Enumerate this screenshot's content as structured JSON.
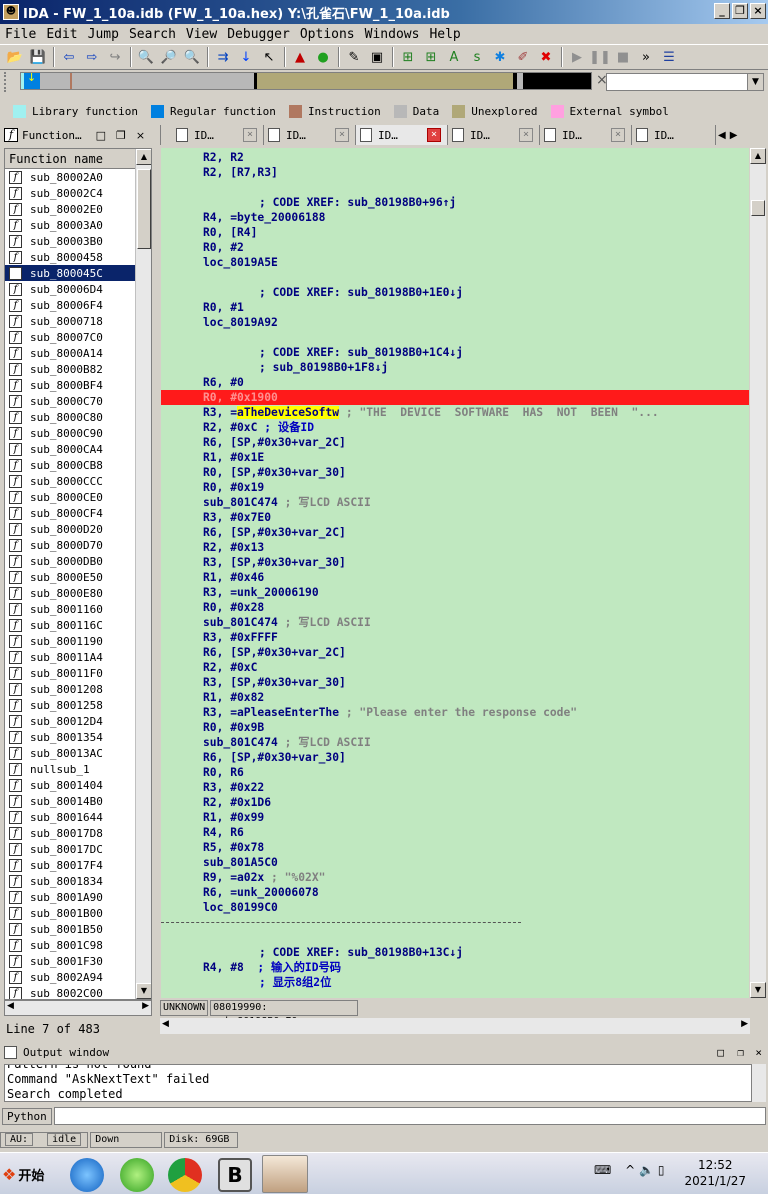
{
  "window": {
    "title": "IDA - FW_1_10a.idb (FW_1_10a.hex) Y:\\孔雀石\\FW_1_10a.idb"
  },
  "menu": [
    "File",
    "Edit",
    "Jump",
    "Search",
    "View",
    "Debugger",
    "Options",
    "Windows",
    "Help"
  ],
  "legend": [
    {
      "label": "Library function",
      "color": "#a0f0f0"
    },
    {
      "label": "Regular function",
      "color": "#0080e0"
    },
    {
      "label": "Instruction",
      "color": "#b07860"
    },
    {
      "label": "Data",
      "color": "#b8b8b8"
    },
    {
      "label": "Unexplored",
      "color": "#b0a878"
    },
    {
      "label": "External symbol",
      "color": "#ffa0e0"
    }
  ],
  "left_tab": {
    "label": "Function…"
  },
  "functions": {
    "header": "Function name",
    "items": [
      "sub_80002A0",
      "sub_80002C4",
      "sub_80002E0",
      "sub_80003A0",
      "sub_80003B0",
      "sub_8000458",
      "sub_800045C",
      "sub_80006D4",
      "sub_80006F4",
      "sub_8000718",
      "sub_80007C0",
      "sub_8000A14",
      "sub_8000B82",
      "sub_8000BF4",
      "sub_8000C70",
      "sub_8000C80",
      "sub_8000C90",
      "sub_8000CA4",
      "sub_8000CB8",
      "sub_8000CCC",
      "sub_8000CE0",
      "sub_8000CF4",
      "sub_8000D20",
      "sub_8000D70",
      "sub_8000DB0",
      "sub_8000E50",
      "sub_8000E80",
      "sub_8001160",
      "sub_800116C",
      "sub_8001190",
      "sub_80011A4",
      "sub_80011F0",
      "sub_8001208",
      "sub_8001258",
      "sub_80012D4",
      "sub_8001354",
      "sub_80013AC",
      "nullsub_1",
      "sub_8001404",
      "sub_80014B0",
      "sub_8001644",
      "sub_80017D8",
      "sub_80017DC",
      "sub_80017F4",
      "sub_8001834",
      "sub_8001A90",
      "sub_8001B00",
      "sub_8001B50",
      "sub_8001C98",
      "sub_8001F30",
      "sub_8002A94",
      "sub_8002C00"
    ],
    "selected_index": 6,
    "line_info": "Line 7 of 483"
  },
  "doc_tabs": [
    "ID…",
    "ID…",
    "ID…",
    "ID…",
    "ID…",
    "ID…"
  ],
  "disasm": [
    {
      "a": "R2, R2"
    },
    {
      "a": "R2, [R7,R3]"
    },
    {
      "blank": true
    },
    {
      "c": "; CODE XREF: sub_80198B0+96↑j",
      "ci": true
    },
    {
      "a": "R4, =byte_20006188"
    },
    {
      "a": "R0, [R4]"
    },
    {
      "a": "R0, #2"
    },
    {
      "a": "loc_8019A5E"
    },
    {
      "blank": true
    },
    {
      "c": "; CODE XREF: sub_80198B0+1E0↓j",
      "ci": true
    },
    {
      "a": "R0, #1"
    },
    {
      "a": "loc_8019A92"
    },
    {
      "blank": true
    },
    {
      "c": "; CODE XREF: sub_80198B0+1C4↓j",
      "ci": true
    },
    {
      "c": "; sub_80198B0+1F8↓j",
      "ci": true
    },
    {
      "a": "R6, #0"
    },
    {
      "a": "R0, #0x1900",
      "bp": true
    },
    {
      "a": "R3, =",
      "h": "aTheDeviceSoftw",
      "c": " ; \"THE  DEVICE  SOFTWARE  HAS  NOT  BEEN  \"..."
    },
    {
      "a": "R2, #0xC",
      "cb": " ; 设备ID"
    },
    {
      "a": "R6, [SP,#0x30+var_2C]"
    },
    {
      "a": "R1, #0x1E"
    },
    {
      "a": "R0, [SP,#0x30+var_30]"
    },
    {
      "a": "R0, #0x19"
    },
    {
      "a": "sub_801C474",
      "c": " ; 写LCD ASCII"
    },
    {
      "a": "R3, #0x7E0"
    },
    {
      "a": "R6, [SP,#0x30+var_2C]"
    },
    {
      "a": "R2, #0x13"
    },
    {
      "a": "R3, [SP,#0x30+var_30]"
    },
    {
      "a": "R1, #0x46"
    },
    {
      "a": "R3, =unk_20006190"
    },
    {
      "a": "R0, #0x28"
    },
    {
      "a": "sub_801C474",
      "c": " ; 写LCD ASCII"
    },
    {
      "a": "R3, #0xFFFF"
    },
    {
      "a": "R6, [SP,#0x30+var_2C]"
    },
    {
      "a": "R2, #0xC"
    },
    {
      "a": "R3, [SP,#0x30+var_30]"
    },
    {
      "a": "R1, #0x82"
    },
    {
      "a": "R3, =aPleaseEnterThe",
      "c": " ; \"Please enter the response code\""
    },
    {
      "a": "R0, #0x9B"
    },
    {
      "a": "sub_801C474",
      "c": " ; 写LCD ASCII"
    },
    {
      "a": "R6, [SP,#0x30+var_30]"
    },
    {
      "a": "R0, R6"
    },
    {
      "a": "R3, #0x22"
    },
    {
      "a": "R2, #0x1D6"
    },
    {
      "a": "R1, #0x99"
    },
    {
      "a": "R4, R6"
    },
    {
      "a": "R5, #0x78"
    },
    {
      "a": "sub_801A5C0"
    },
    {
      "a": "R9, =a02x",
      "c": " ; \"%02X\""
    },
    {
      "a": "R6, =unk_20006078"
    },
    {
      "a": "loc_80199C0"
    },
    {
      "sep": true
    },
    {
      "blank": true
    },
    {
      "c": "; CODE XREF: sub_80198B0+13C↓j",
      "ci": true
    },
    {
      "a": "R4, #8",
      "cb2": "  ; 输入的ID号码"
    },
    {
      "cb": "; 显示8组2位",
      "ci": true
    }
  ],
  "status_line": {
    "seg": "UNKNOWN",
    "addr": "08019990: sub_80198B0+E0"
  },
  "output": {
    "title": "Output window",
    "lines": [
      "Pattern is not found",
      "Command \"AskNextText\" failed",
      "Search completed"
    ],
    "python_label": "Python"
  },
  "status_bar": {
    "au": "AU:",
    "state": "idle",
    "dir": "Down",
    "disk": "Disk: 69GB"
  },
  "taskbar": {
    "start": "开始",
    "time": "12:52",
    "date": "2021/1/27"
  }
}
